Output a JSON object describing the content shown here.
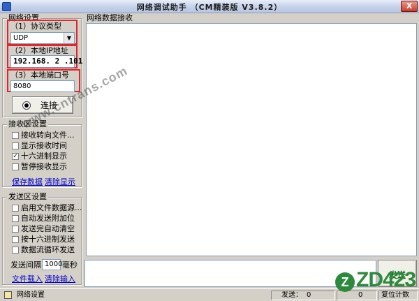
{
  "window": {
    "title": "网络调试助手 （CM精装版 V3.8.2）",
    "close_label": "X"
  },
  "network_settings": {
    "group_title": "网络设置",
    "protocol": {
      "label": "（1）协议类型",
      "value": "UDP"
    },
    "local_ip": {
      "label": "（2）本地IP地址",
      "value": "192.168. 2 .101"
    },
    "local_port": {
      "label": "（3）本地端口号",
      "value": "8080"
    },
    "connect_button": {
      "label": "连接"
    }
  },
  "receive_settings": {
    "group_title": "接收区设置",
    "options": [
      {
        "label": "接收转向文件...",
        "checked": false
      },
      {
        "label": "显示接收时间",
        "checked": false
      },
      {
        "label": "十六进制显示",
        "checked": true
      },
      {
        "label": "暂停接收显示",
        "checked": false
      }
    ],
    "save_data_link": "保存数据",
    "clear_display_link": "清除显示"
  },
  "send_settings": {
    "group_title": "发送区设置",
    "options": [
      {
        "label": "启用文件数据源...",
        "checked": false
      },
      {
        "label": "自动发送附加位",
        "checked": false
      },
      {
        "label": "发送完自动清空",
        "checked": false
      },
      {
        "label": "按十六进制发送",
        "checked": false
      },
      {
        "label": "数据流循环发送",
        "checked": false
      }
    ],
    "interval_label": "发送间隔",
    "interval_value": "1000",
    "interval_unit": "毫秒",
    "file_load_link": "文件载入",
    "clear_input_link": "清除输入"
  },
  "receive_area": {
    "group_title": "网络数据接收"
  },
  "send_button": {
    "label": "发送"
  },
  "status_bar": {
    "mode_label": "网络设置",
    "send_label": "发送：",
    "send_count": "0",
    "recv_count": "0",
    "reset_label": "复位计数"
  },
  "watermark": {
    "text": "www.cntrans.com"
  },
  "logo": {
    "text": "ZD423",
    "mark": "Z"
  },
  "colors": {
    "highlight_box": "#e0262d",
    "window_bg": "#d4d0c8",
    "title_gradient": "#c7d3ea",
    "logo": "#2c8a3c"
  }
}
